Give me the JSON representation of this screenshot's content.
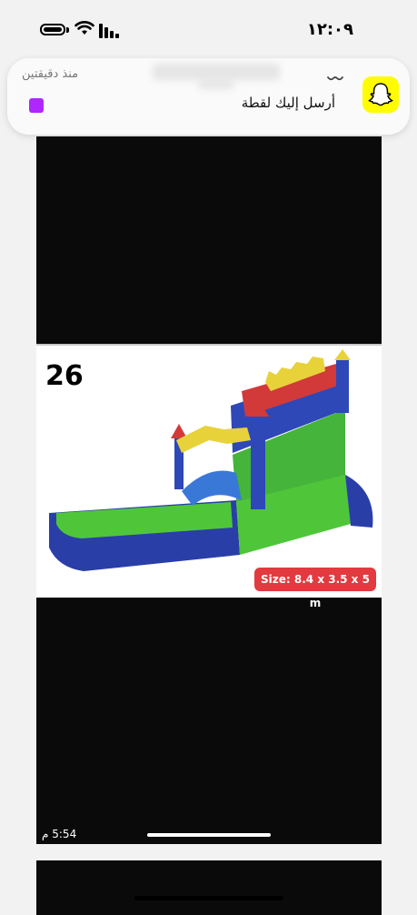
{
  "status_bar": {
    "time": "١٢:٠٩"
  },
  "notification": {
    "app": "Snapchat",
    "time": "منذ دقيقتين",
    "message": "أرسل إليك لقطة",
    "icon": "snapchat-ghost-icon"
  },
  "chat": {
    "product": {
      "number": "26",
      "size_label": "Size: 8.4 x 3.5 x 5 m"
    },
    "timestamp": "5:54 م"
  },
  "colors": {
    "snapchat_yellow": "#fffc00",
    "size_badge_red": "#e23a3e",
    "avatar_purple": "#b026ff"
  }
}
